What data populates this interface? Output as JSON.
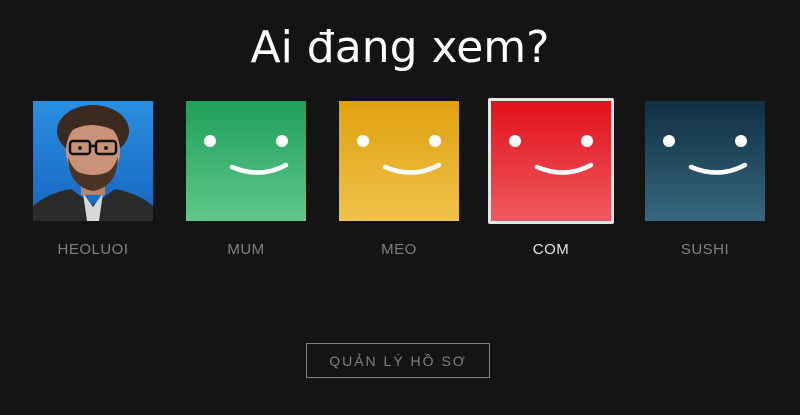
{
  "page": {
    "title": "Ai đang xem?"
  },
  "profiles": [
    {
      "name": "HEOLUOI",
      "type": "photo",
      "selected": false
    },
    {
      "name": "MUM",
      "type": "smiley",
      "color_top": "#1f9f5a",
      "color_bottom": "#5fc78b",
      "selected": false
    },
    {
      "name": "MEO",
      "type": "smiley",
      "color_top": "#e0a10f",
      "color_bottom": "#efc24a",
      "selected": false
    },
    {
      "name": "COM",
      "type": "smiley",
      "color_top": "#e1101b",
      "color_bottom": "#f05a5f",
      "selected": true
    },
    {
      "name": "SUSHI",
      "type": "smiley",
      "color_top": "#0f2f42",
      "color_bottom": "#37677e",
      "selected": false
    }
  ],
  "manage_button": {
    "label": "QUẢN LÝ HỒ SƠ"
  },
  "colors": {
    "background": "#141414",
    "text_muted": "#808080",
    "text_active": "#e5e5e5"
  }
}
